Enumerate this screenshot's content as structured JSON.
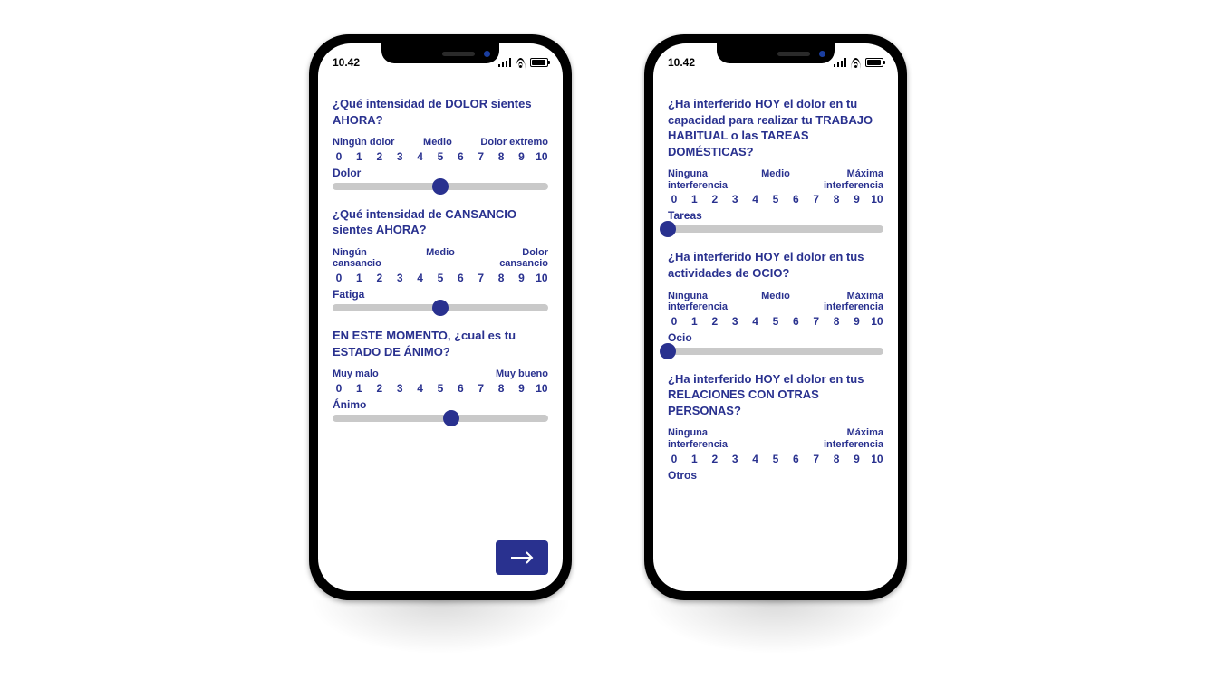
{
  "status": {
    "time": "10.42"
  },
  "ticks": [
    "0",
    "1",
    "2",
    "3",
    "4",
    "5",
    "6",
    "7",
    "8",
    "9",
    "10"
  ],
  "left": {
    "q1": {
      "text": "¿Qué intensidad de DOLOR sientes AHORA?",
      "anchor_left": "Ningún dolor",
      "anchor_mid": "Medio",
      "anchor_right": "Dolor extremo",
      "slider_label": "Dolor",
      "value": 5
    },
    "q2": {
      "text": "¿Qué intensidad de CANSANCIO sientes AHORA?",
      "anchor_left": "Ningún cansancio",
      "anchor_mid": "Medio",
      "anchor_right": "Dolor cansancio",
      "slider_label": "Fatiga",
      "value": 5
    },
    "q3": {
      "text": "EN ESTE MOMENTO, ¿cual es tu ESTADO DE ÁNIMO?",
      "anchor_left": "Muy malo",
      "anchor_right": "Muy bueno",
      "slider_label": "Ánimo",
      "value": 5.5
    }
  },
  "right": {
    "q1": {
      "text": "¿Ha interferido HOY el dolor en tu capacidad para realizar tu TRABAJO HABITUAL o las TAREAS DOMÉSTICAS?",
      "anchor_left": "Ninguna interferencia",
      "anchor_mid": "Medio",
      "anchor_right": "Máxima interferencia",
      "slider_label": "Tareas",
      "value": 0
    },
    "q2": {
      "text": "¿Ha interferido HOY el dolor en tus actividades de OCIO?",
      "anchor_left": "Ninguna interferencia",
      "anchor_mid": "Medio",
      "anchor_right": "Máxima interferencia",
      "slider_label": "Ocio",
      "value": 0
    },
    "q3": {
      "text": "¿Ha interferido HOY el dolor en tus RELACIONES CON OTRAS PERSONAS?",
      "anchor_left": "Ninguna interferencia",
      "anchor_right": "Máxima interferencia",
      "slider_label": "Otros"
    }
  }
}
